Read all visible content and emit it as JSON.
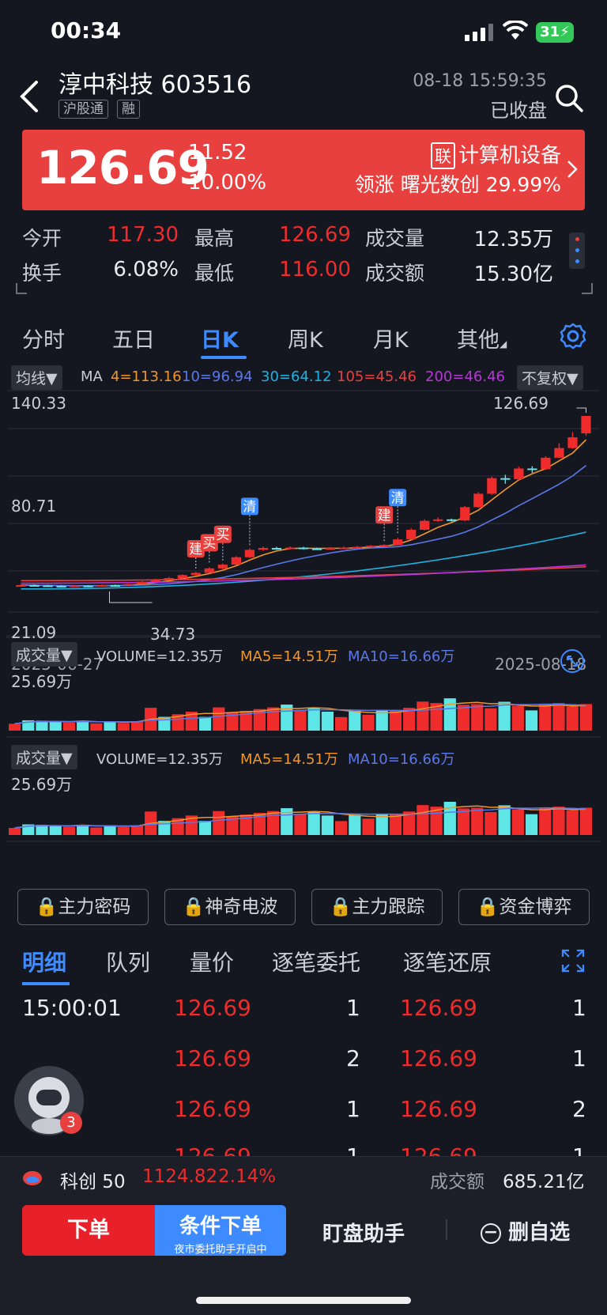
{
  "status_bar": {
    "time": "00:34",
    "battery": "31"
  },
  "header": {
    "stock_name": "淳中科技 603516",
    "tags": [
      "沪股通",
      "融"
    ],
    "datetime": "08-18 15:59:35",
    "market_status": "已收盘"
  },
  "quote": {
    "price": "126.69",
    "change": "11.52",
    "change_pct": "10.00%",
    "sector_tag": "联",
    "sector": "计算机设备",
    "leader_label": "领涨",
    "leader_name": "曙光数创",
    "leader_pct": "29.99%",
    "up_color": "#ef2b2b",
    "banner_color": "#e8403f",
    "stats": [
      {
        "label": "今开",
        "value": "117.30",
        "color": "red"
      },
      {
        "label": "最高",
        "value": "126.69",
        "color": "red"
      },
      {
        "label": "成交量",
        "value": "12.35万",
        "color": "white"
      },
      {
        "label": "换手",
        "value": "6.08%",
        "color": "white"
      },
      {
        "label": "最低",
        "value": "116.00",
        "color": "red"
      },
      {
        "label": "成交额",
        "value": "15.30亿",
        "color": "white"
      }
    ]
  },
  "chart_tabs": [
    "分时",
    "五日",
    "日K",
    "周K",
    "月K",
    "其他"
  ],
  "active_chart_tab": "日K",
  "kline": {
    "indicator_dropdown": "均线▼",
    "ma_prefix": "MA",
    "ma_values": [
      {
        "label": "4=113.16",
        "color": "#f0962a"
      },
      {
        "label": "10=96.94",
        "color": "#5a78e8"
      },
      {
        "label": "30=64.12",
        "color": "#22b0e0"
      },
      {
        "label": "105=45.46",
        "color": "#e8403f"
      },
      {
        "label": "200=46.46",
        "color": "#b836d6"
      }
    ],
    "adjust_dropdown": "不复权▼",
    "y_top": "140.33",
    "y_mid": "80.71",
    "y_low": "21.09",
    "max_label": "126.69",
    "min_label": "34.73",
    "date_start": "2025-06-27",
    "date_end": "2025-08-18",
    "markers": [
      "建",
      "买",
      "买",
      "清",
      "建",
      "清"
    ]
  },
  "volume_panels": [
    {
      "dropdown": "成交量▼",
      "volume": "VOLUME=12.35万",
      "ma5": "MA5=14.51万",
      "ma10": "MA10=16.66万",
      "y_top": "25.69万"
    },
    {
      "dropdown": "成交量▼",
      "volume": "VOLUME=12.35万",
      "ma5": "MA5=14.51万",
      "ma10": "MA10=16.66万",
      "y_top": "25.69万"
    }
  ],
  "chart_data": {
    "type": "bar",
    "title": "",
    "x_range": [
      "2025-06-27",
      "2025-08-18"
    ],
    "kline_ylim": [
      21.09,
      140.33
    ],
    "candles": [
      {
        "o": 35.0,
        "c": 35.6,
        "h": 36.0,
        "l": 34.73
      },
      {
        "o": 35.6,
        "c": 35.4,
        "h": 36.0,
        "l": 35.0
      },
      {
        "o": 35.4,
        "c": 35.2,
        "h": 35.8,
        "l": 34.9
      },
      {
        "o": 35.2,
        "c": 35.0,
        "h": 35.6,
        "l": 34.8
      },
      {
        "o": 35.0,
        "c": 35.3,
        "h": 35.6,
        "l": 34.8
      },
      {
        "o": 35.3,
        "c": 35.1,
        "h": 35.6,
        "l": 34.9
      },
      {
        "o": 35.1,
        "c": 35.6,
        "h": 35.9,
        "l": 34.9
      },
      {
        "o": 35.6,
        "c": 35.4,
        "h": 35.9,
        "l": 35.1
      },
      {
        "o": 35.4,
        "c": 36.2,
        "h": 36.4,
        "l": 35.2
      },
      {
        "o": 36.2,
        "c": 37.4,
        "h": 37.8,
        "l": 36.0
      },
      {
        "o": 37.4,
        "c": 38.6,
        "h": 39.0,
        "l": 37.1
      },
      {
        "o": 38.6,
        "c": 39.4,
        "h": 40.0,
        "l": 38.2
      },
      {
        "o": 39.4,
        "c": 41.0,
        "h": 41.4,
        "l": 39.0
      },
      {
        "o": 41.0,
        "c": 42.2,
        "h": 42.8,
        "l": 40.8
      },
      {
        "o": 42.2,
        "c": 44.6,
        "h": 45.2,
        "l": 42.0
      },
      {
        "o": 44.6,
        "c": 46.6,
        "h": 47.2,
        "l": 44.2
      },
      {
        "o": 46.6,
        "c": 50.6,
        "h": 51.2,
        "l": 46.4
      },
      {
        "o": 50.6,
        "c": 54.6,
        "h": 55.4,
        "l": 50.2
      },
      {
        "o": 54.6,
        "c": 55.6,
        "h": 56.4,
        "l": 54.0
      },
      {
        "o": 55.6,
        "c": 55.2,
        "h": 56.2,
        "l": 54.6
      },
      {
        "o": 55.2,
        "c": 55.8,
        "h": 56.4,
        "l": 54.8
      },
      {
        "o": 55.8,
        "c": 55.3,
        "h": 56.2,
        "l": 54.8
      },
      {
        "o": 55.3,
        "c": 55.0,
        "h": 55.8,
        "l": 54.6
      },
      {
        "o": 55.0,
        "c": 55.6,
        "h": 56.0,
        "l": 54.6
      },
      {
        "o": 55.6,
        "c": 55.8,
        "h": 56.4,
        "l": 55.2
      },
      {
        "o": 55.8,
        "c": 56.2,
        "h": 56.6,
        "l": 55.4
      },
      {
        "o": 56.2,
        "c": 56.8,
        "h": 57.2,
        "l": 55.8
      },
      {
        "o": 56.8,
        "c": 57.2,
        "h": 57.6,
        "l": 56.4
      },
      {
        "o": 57.2,
        "c": 60.2,
        "h": 61.0,
        "l": 57.0
      },
      {
        "o": 60.2,
        "c": 65.4,
        "h": 66.2,
        "l": 60.0
      },
      {
        "o": 65.4,
        "c": 70.2,
        "h": 71.0,
        "l": 65.0
      },
      {
        "o": 70.2,
        "c": 71.0,
        "h": 72.0,
        "l": 69.6
      },
      {
        "o": 71.0,
        "c": 70.4,
        "h": 71.4,
        "l": 69.8
      },
      {
        "o": 70.4,
        "c": 77.6,
        "h": 78.2,
        "l": 70.0
      },
      {
        "o": 77.6,
        "c": 84.8,
        "h": 85.6,
        "l": 77.2
      },
      {
        "o": 84.8,
        "c": 93.2,
        "h": 94.0,
        "l": 84.2
      },
      {
        "o": 93.2,
        "c": 92.6,
        "h": 95.0,
        "l": 90.2
      },
      {
        "o": 92.6,
        "c": 98.4,
        "h": 99.4,
        "l": 92.2
      },
      {
        "o": 98.4,
        "c": 98.0,
        "h": 99.6,
        "l": 96.0
      },
      {
        "o": 98.0,
        "c": 104.2,
        "h": 105.0,
        "l": 97.6
      },
      {
        "o": 104.2,
        "c": 109.4,
        "h": 112.0,
        "l": 104.0
      },
      {
        "o": 109.4,
        "c": 115.2,
        "h": 118.0,
        "l": 109.0
      },
      {
        "o": 117.3,
        "c": 126.69,
        "h": 126.69,
        "l": 116.0
      }
    ],
    "volume_ylim": [
      0,
      25.69
    ],
    "volumes": [
      3.2,
      4.8,
      4.6,
      4.4,
      3.8,
      4.6,
      3.4,
      4.4,
      3.6,
      4.4,
      10.6,
      6.4,
      7.6,
      8.8,
      6.4,
      10.8,
      8.6,
      9.2,
      10.0,
      10.8,
      12.1,
      9.6,
      10.6,
      8.8,
      6.3,
      9.2,
      7.4,
      9.6,
      9.6,
      10.6,
      13.5,
      12.8,
      15.0,
      12.0,
      12.3,
      10.4,
      13.4,
      11.6,
      9.4,
      12.4,
      12.8,
      11.2,
      12.35
    ],
    "volume_up": [
      true,
      false,
      false,
      false,
      true,
      false,
      true,
      false,
      true,
      true,
      true,
      false,
      true,
      true,
      false,
      true,
      true,
      true,
      true,
      true,
      false,
      true,
      false,
      false,
      true,
      false,
      true,
      false,
      true,
      true,
      true,
      true,
      false,
      true,
      true,
      true,
      false,
      true,
      false,
      true,
      true,
      true,
      true
    ]
  },
  "function_buttons": [
    "主力密码",
    "神奇电波",
    "主力跟踪",
    "资金博弈"
  ],
  "detail_tabs": [
    "明细",
    "队列",
    "量价",
    "逐笔委托",
    "逐笔还原"
  ],
  "active_detail_tab": "明细",
  "trades": [
    {
      "time": "15:00:01",
      "p1": "126.69",
      "v1": "1",
      "p2": "126.69",
      "v2": "1"
    },
    {
      "time": "",
      "p1": "126.69",
      "v1": "2",
      "p2": "126.69",
      "v2": "1"
    },
    {
      "time": "",
      "p1": "126.69",
      "v1": "1",
      "p2": "126.69",
      "v2": "2"
    },
    {
      "time": "",
      "p1": "126.69",
      "v1": "1",
      "p2": "126.69",
      "v2": "1"
    }
  ],
  "avatar_badge": "3",
  "index_bar": {
    "name": "科创 50",
    "value": "1124.82",
    "pct": "2.14%",
    "turnover_label": "成交额",
    "turnover": "685.21亿"
  },
  "bottom_bar": {
    "order": "下单",
    "cond_order": "条件下单",
    "cond_sub": "夜市委托助手开启中",
    "assistant": "盯盘助手",
    "remove": "删自选"
  }
}
